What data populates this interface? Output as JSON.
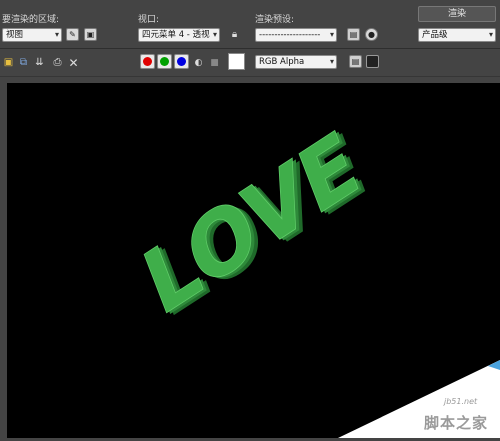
{
  "area_to_render": {
    "label": "要渲染的区域:",
    "value": "视图"
  },
  "viewport": {
    "label": "视口:",
    "value": "四元菜单 4 - 透视"
  },
  "render_preset": {
    "label": "渲染预设:",
    "value": "--------------------"
  },
  "render_button": {
    "label": "渲染"
  },
  "quality": {
    "value": "产品级"
  },
  "channel": {
    "value": "RGB Alpha"
  },
  "colors": {
    "red": "#e00000",
    "green": "#00a000",
    "blue": "#0000e0",
    "text_green": "#3fae4a"
  },
  "scene": {
    "text": "LOVE"
  },
  "watermark": {
    "site": "jb51.net",
    "brand": "脚本之家"
  }
}
